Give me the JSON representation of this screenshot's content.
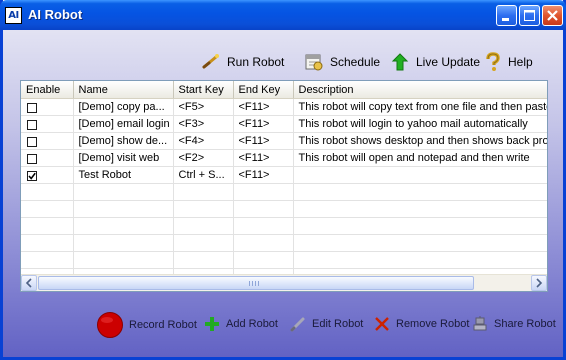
{
  "window": {
    "app_icon_text": "AI",
    "title": "AI Robot"
  },
  "toolbar": {
    "run_label": "Run Robot",
    "schedule_label": "Schedule",
    "live_update_label": "Live Update",
    "help_label": "Help"
  },
  "table": {
    "headers": {
      "enable": "Enable",
      "name": "Name",
      "start_key": "Start Key",
      "end_key": "End Key",
      "description": "Description"
    },
    "rows": [
      {
        "enabled": false,
        "name": "[Demo] copy pa...",
        "start_key": "<F5>",
        "end_key": "<F11>",
        "description": "This robot will copy text from one file and then paste it"
      },
      {
        "enabled": false,
        "name": "[Demo] email login",
        "start_key": "<F3>",
        "end_key": "<F11>",
        "description": "This robot will login to yahoo mail automatically"
      },
      {
        "enabled": false,
        "name": "[Demo] show de...",
        "start_key": "<F4>",
        "end_key": "<F11>",
        "description": "This robot shows desktop and then shows back programs"
      },
      {
        "enabled": false,
        "name": "[Demo] visit web",
        "start_key": "<F2>",
        "end_key": "<F11>",
        "description": "This robot will open and notepad and then write"
      },
      {
        "enabled": true,
        "name": "Test Robot",
        "start_key": "Ctrl + S...",
        "end_key": "<F11>",
        "description": ""
      }
    ]
  },
  "actions": {
    "record_label": "Record Robot",
    "add_label": "Add Robot",
    "edit_label": "Edit Robot",
    "remove_label": "Remove Robot",
    "share_label": "Share Robot"
  },
  "colors": {
    "titlebar": "#0554e3",
    "record": "#cc0000",
    "add": "#22aa22",
    "remove": "#cc2200"
  }
}
